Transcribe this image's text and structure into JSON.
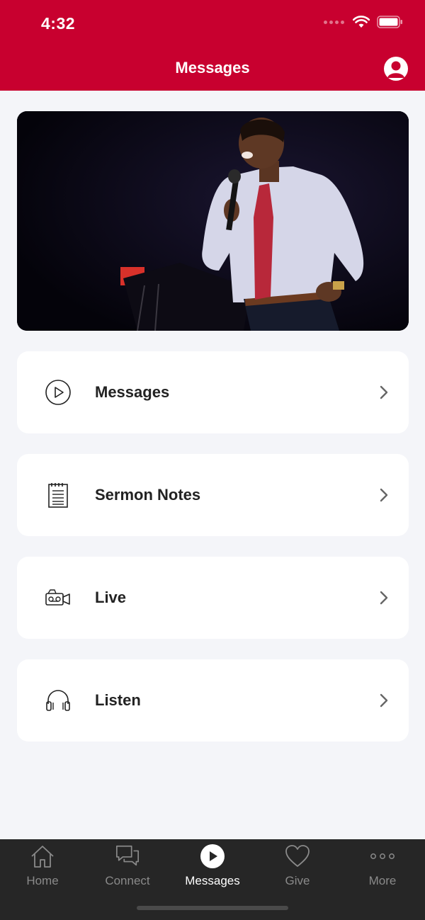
{
  "status_bar": {
    "time": "4:32"
  },
  "header": {
    "title": "Messages"
  },
  "menu": [
    {
      "label": "Messages",
      "icon": "play-circle-icon"
    },
    {
      "label": "Sermon Notes",
      "icon": "notepad-icon"
    },
    {
      "label": "Live",
      "icon": "video-camera-icon"
    },
    {
      "label": "Listen",
      "icon": "headphones-icon"
    }
  ],
  "tabbar": [
    {
      "label": "Home",
      "icon": "home-icon",
      "active": false
    },
    {
      "label": "Connect",
      "icon": "chat-bubbles-icon",
      "active": false
    },
    {
      "label": "Messages",
      "icon": "play-circle-icon",
      "active": true
    },
    {
      "label": "Give",
      "icon": "heart-icon",
      "active": false
    },
    {
      "label": "More",
      "icon": "more-dots-icon",
      "active": false
    }
  ],
  "colors": {
    "brand": "#c8002f",
    "tabbar": "#262626",
    "background": "#f4f5f9"
  }
}
